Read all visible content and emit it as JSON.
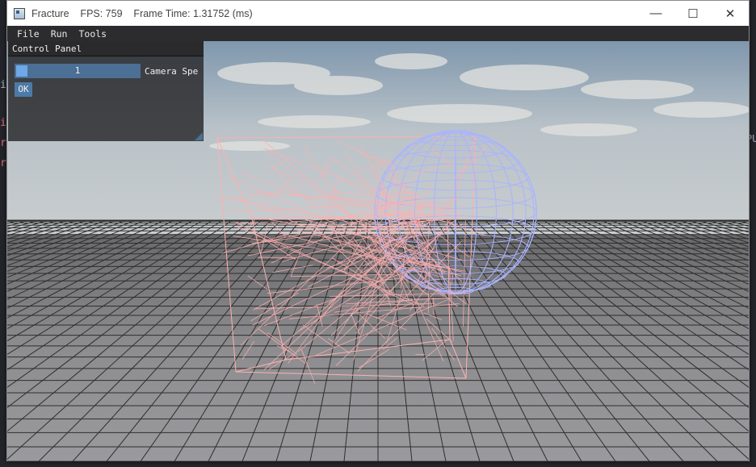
{
  "window": {
    "app_name": "Fracture",
    "title_text": "Fracture    FPS: 759    Frame Time: 1.31752 (ms)",
    "controls": {
      "minimize": "—",
      "maximize": "☐",
      "close": "✕"
    }
  },
  "menu": {
    "items": [
      {
        "label": "File"
      },
      {
        "label": "Run"
      },
      {
        "label": "Tools"
      }
    ]
  },
  "control_panel": {
    "title": "Control Panel",
    "slider_value": "1",
    "slider_label": "Camera Spe",
    "ok_label": "OK"
  },
  "scene": {
    "cube_color": "#ffb0b0",
    "sphere_color": "#aab4ff",
    "grid_color": "#2e2e2e",
    "floor_color": "#8a8a8c"
  },
  "background_editor": {
    "glyphs": [
      "i",
      "i",
      "r",
      "r",
      "PU"
    ]
  }
}
